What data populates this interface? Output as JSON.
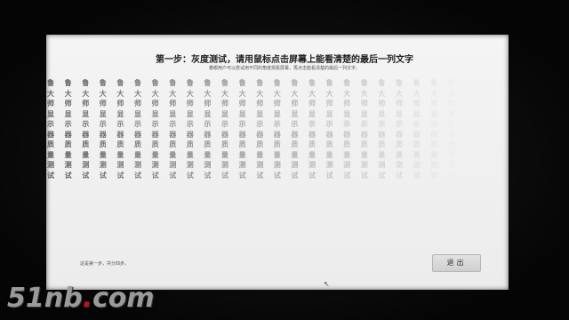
{
  "screen": {
    "title": "第一步：灰度测试，请用鼠标点击屏幕上能看清楚的最后一列文字",
    "subtitle": "着眼用户可以尝试用不同的角度观看屏幕，再点击能看清楚的最后一列文字。",
    "column_chars": [
      "鲁",
      "大",
      "师",
      "显",
      "示",
      "器",
      "质",
      "量",
      "测",
      "试"
    ],
    "column_count": 24,
    "status_text": "这是第一步，共分四步。",
    "exit_label": "退出"
  },
  "watermark": {
    "prefix": "51nb",
    "dot": ".",
    "suffix": "com"
  }
}
